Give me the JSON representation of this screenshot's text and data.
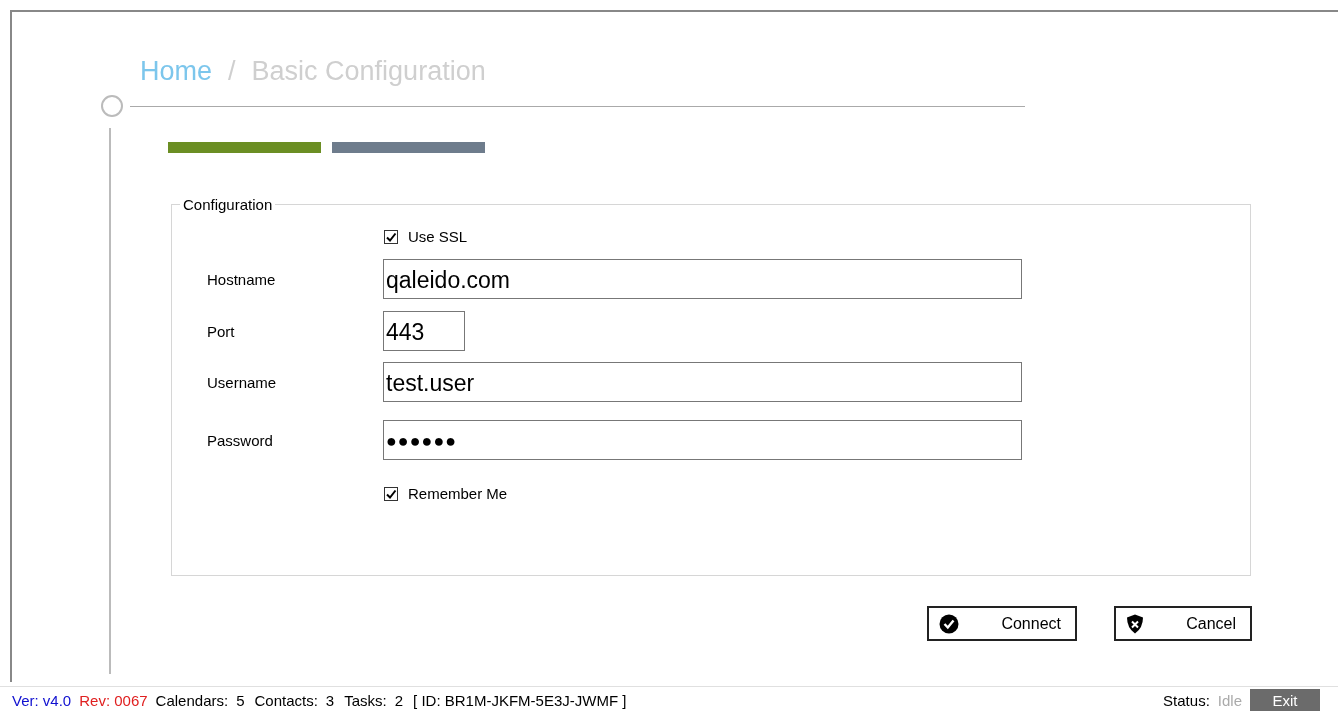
{
  "breadcrumb": {
    "home": "Home",
    "separator": "/",
    "current": "Basic Configuration"
  },
  "steps": [
    {
      "selected": true
    },
    {
      "selected": false
    }
  ],
  "configuration": {
    "legend": "Configuration",
    "use_ssl": {
      "label": "Use SSL",
      "checked": true
    },
    "fields": [
      {
        "label": "Hostname",
        "value": "qaleido.com",
        "kind": "text"
      },
      {
        "label": "Port",
        "value": "443",
        "kind": "short"
      },
      {
        "label": "Username",
        "value": "test.user",
        "kind": "text"
      },
      {
        "label": "Password",
        "value": "●●●●●●",
        "kind": "password"
      }
    ],
    "remember_me": {
      "label": "Remember Me",
      "checked": true
    }
  },
  "buttons": [
    {
      "label": "Connect",
      "kind": "confirm"
    },
    {
      "label": "Cancel",
      "kind": "cancel"
    }
  ],
  "status_bar": {
    "version": "Ver: v4.0",
    "revision": "Rev: 0067",
    "counts": [
      {
        "label": "Calendars:",
        "value": "5"
      },
      {
        "label": "Contacts:",
        "value": "3"
      },
      {
        "label": "Tasks:",
        "value": "2"
      }
    ],
    "id": "[ ID: BR1M-JKFM-5E3J-JWMF ]",
    "status_label": "Status:",
    "status_value": "Idle",
    "exit": "Exit"
  }
}
